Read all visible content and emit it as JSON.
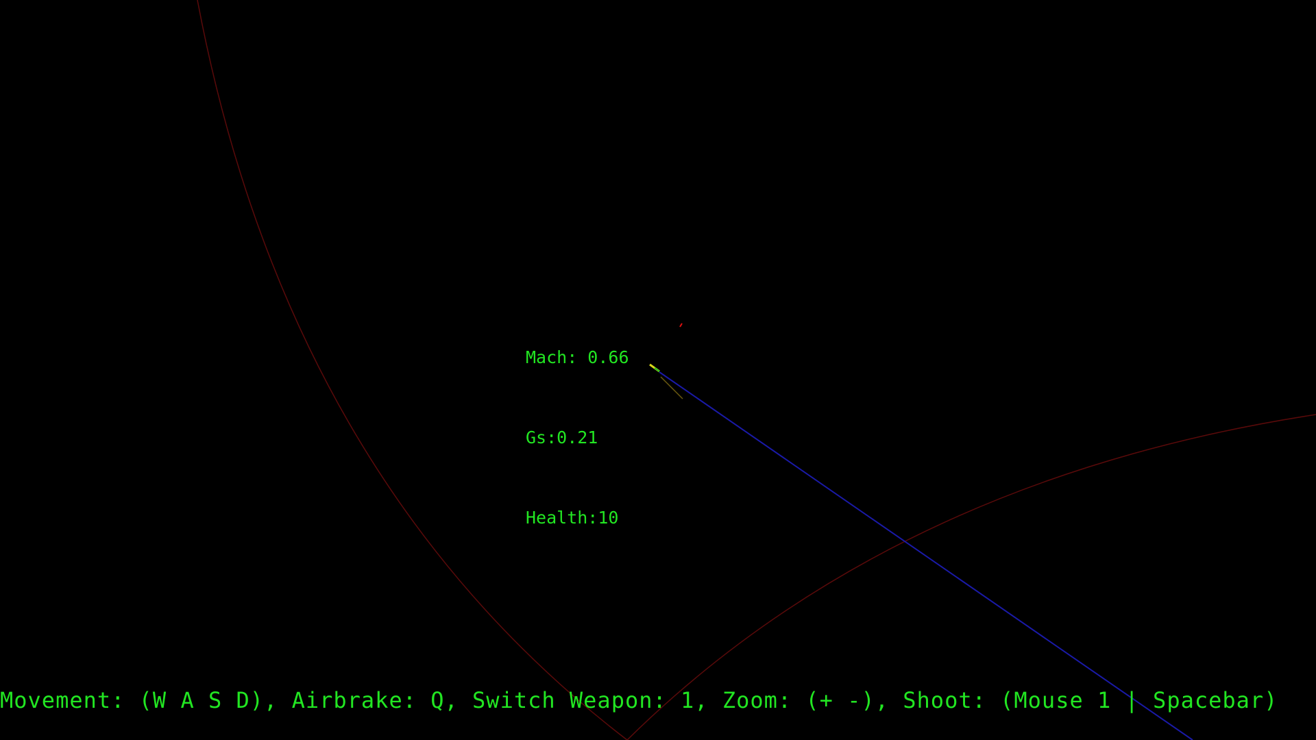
{
  "hud": {
    "mach": "Mach: 0.66",
    "gs": "Gs:0.21",
    "health": "Health:10"
  },
  "controls_hint": "Movement: (W A S D), Airbrake: Q, Switch Weapon: 1, Zoom: (+ -), Shoot: (Mouse 1 | Spacebar)",
  "colors": {
    "background": "#000000",
    "hud_text": "#22e622",
    "range_ring": "#5a0a0a",
    "trajectory": "#1a1aa8",
    "player": "#d8d81a",
    "enemy": "#e01010"
  }
}
